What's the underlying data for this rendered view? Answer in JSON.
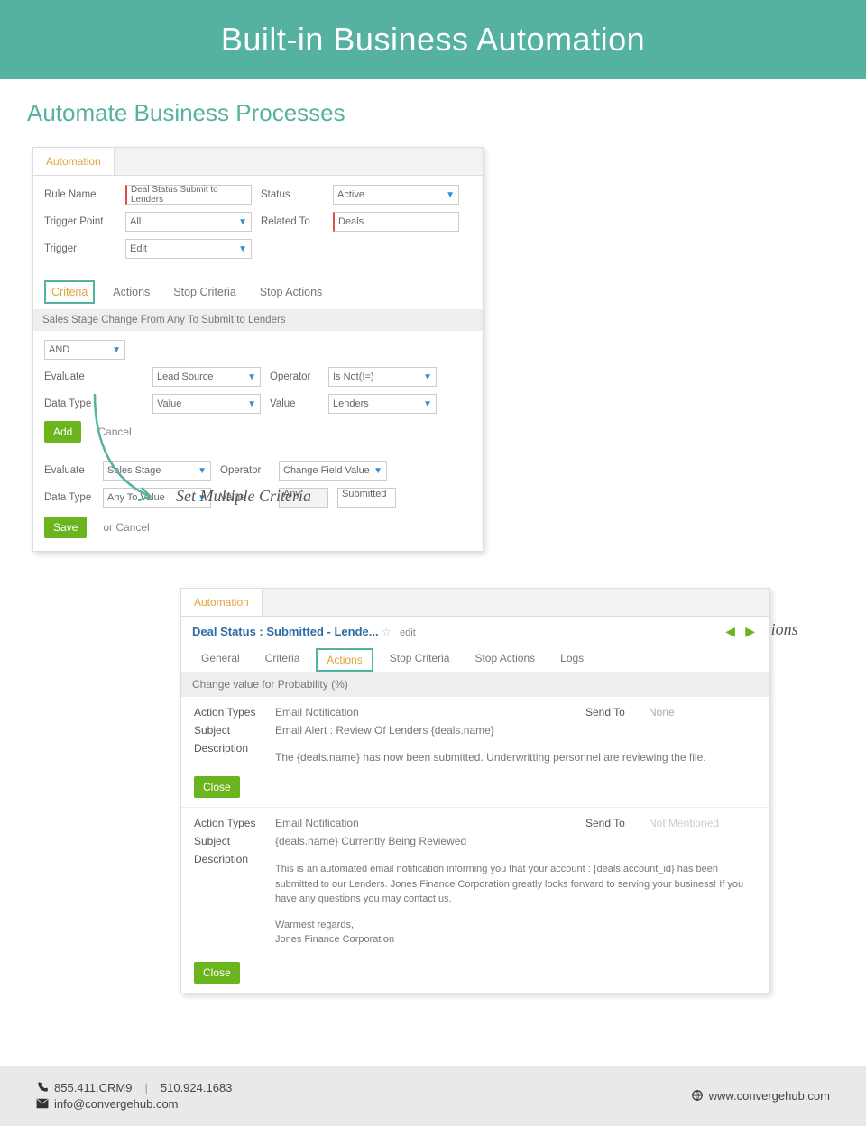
{
  "banner": {
    "title": "Built-in Business Automation"
  },
  "section_title": "Automate Business Processes",
  "panel1": {
    "tab": "Automation",
    "fields": {
      "rule_name_label": "Rule Name",
      "rule_name_value": "Deal Status Submit to Lenders",
      "status_label": "Status",
      "status_value": "Active",
      "trigger_point_label": "Trigger Point",
      "trigger_point_value": "All",
      "related_to_label": "Related To",
      "related_to_value": "Deals",
      "trigger_label": "Trigger",
      "trigger_value": "Edit"
    },
    "subtabs": [
      "Criteria",
      "Actions",
      "Stop Criteria",
      "Stop Actions"
    ],
    "criteria_summary": "Sales Stage Change From Any To Submit to Lenders",
    "criteria": {
      "logic": "AND",
      "evaluate_label": "Evaluate",
      "evaluate_value": "Lead Source",
      "operator_label": "Operator",
      "operator_value": "Is Not(!=)",
      "datatype_label": "Data Type",
      "datatype_value": "Value",
      "value_label": "Value",
      "value_value": "Lenders",
      "add": "Add",
      "cancel": "Cancel"
    },
    "criteria2": {
      "evaluate_label": "Evaluate",
      "evaluate_value": "Sales Stage",
      "operator_label": "Operator",
      "operator_value": "Change Field Value",
      "datatype_label": "Data Type",
      "datatype_value": "Any To Value",
      "value_label": "Value",
      "value_from": "Any",
      "value_to": "Submitted"
    },
    "save": "Save",
    "or_cancel": "or  Cancel"
  },
  "annot1": "Set Multiple Criteria",
  "annot2": "Criteria Based Actions",
  "panel2": {
    "tab": "Automation",
    "title": "Deal Status : Submitted - Lende...",
    "edit": "edit",
    "subtabs": [
      "General",
      "Criteria",
      "Actions",
      "Stop Criteria",
      "Stop Actions",
      "Logs"
    ],
    "strip": "Change value for Probability (%)",
    "action1": {
      "type_label": "Action Types",
      "type_value": "Email Notification",
      "sendto_label": "Send To",
      "sendto_value": "None",
      "subject_label": "Subject",
      "subject_value": "Email Alert : Review Of Lenders {deals.name}",
      "desc_label": "Description",
      "desc_value": "The {deals.name} has now been submitted. Underwritting personnel are reviewing the file.",
      "close": "Close"
    },
    "action2": {
      "type_label": "Action Types",
      "type_value": "Email Notification",
      "sendto_label": "Send To",
      "sendto_value": "Not Mentioned",
      "subject_label": "Subject",
      "subject_value": "{deals.name} Currently Being Reviewed",
      "desc_label": "Description",
      "desc_value1": "This is an automated email notification informing you that your account : {deals:account_id} has been submitted to our Lenders. Jones Finance Corporation greatly looks forward to serving your business! If you have any questions you may contact us.",
      "desc_value2": "Warmest regards,",
      "desc_value3": "Jones Finance Corporation",
      "close": "Close"
    }
  },
  "footer": {
    "phone1": "855.411.CRM9",
    "sep": "|",
    "phone2": "510.924.1683",
    "email": "info@convergehub.com",
    "web": "www.convergehub.com"
  }
}
